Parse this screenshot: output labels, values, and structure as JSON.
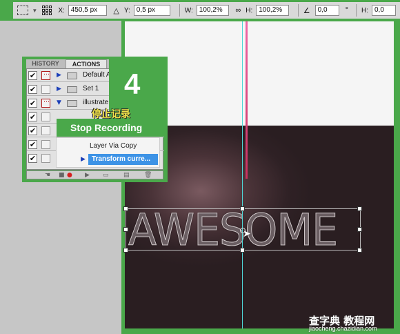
{
  "options_bar": {
    "x_label": "X:",
    "x_value": "450,5 px",
    "y_label": "Y:",
    "y_value": "0,5 px",
    "w_label": "W:",
    "w_value": "100,2%",
    "h_label": "H:",
    "h_value": "100,2%",
    "angle_value": "0,0",
    "h_skew_label": "H:",
    "h_skew_value": "0,0"
  },
  "canvas": {
    "text": "AWESOME"
  },
  "panel": {
    "tabs": [
      "HISTORY",
      "ACTIONS"
    ],
    "actions": [
      {
        "name": "Default A",
        "checked": true,
        "dialog": true
      },
      {
        "name": "Set 1",
        "checked": true,
        "dialog": false
      },
      {
        "name": "illustrate",
        "checked": true,
        "dialog": true
      },
      {
        "name": "",
        "checked": true,
        "dialog": false
      },
      {
        "name": "",
        "checked": true,
        "dialog": false
      },
      {
        "name": "",
        "checked": true,
        "dialog": false
      },
      {
        "name": "",
        "checked": true,
        "dialog": false
      }
    ],
    "sub_items": {
      "layer_via_copy": "Layer Via Copy",
      "transform": "Transform curre..."
    }
  },
  "overlay": {
    "step_number": "4",
    "caption_cn": "停止记录",
    "caption_en": "Stop Recording"
  },
  "watermark": {
    "line1": "查字典 教程网",
    "line2": "jiaocheng.chazidian.com"
  },
  "colors": {
    "accent_green": "#4aa84a",
    "selection_blue": "#3d93e6",
    "guide_cyan": "#4fd6d6",
    "guide_pink": "#e0508a"
  }
}
